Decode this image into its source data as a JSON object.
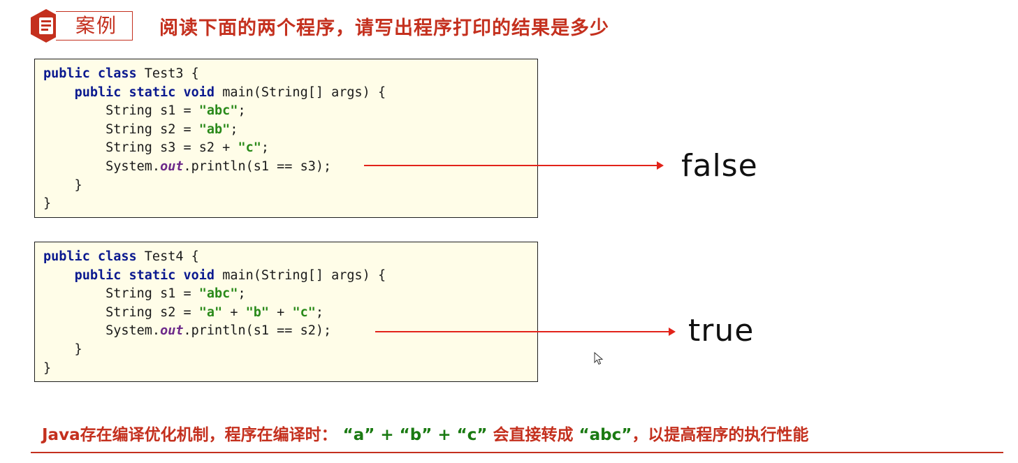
{
  "header": {
    "badge_label": "案例",
    "title": "阅读下面的两个程序，请写出程序打印的结果是多少"
  },
  "programs": [
    {
      "class_name": "Test3",
      "result": "false",
      "lines": [
        "public class Test3 {",
        "public static void main(String[] args) {",
        "String s1 = \"abc\";",
        "String s2 = \"ab\";",
        "String s3 = s2 + \"c\";",
        "System.out.println(s1 == s3);",
        "}",
        "}"
      ]
    },
    {
      "class_name": "Test4",
      "result": "true",
      "lines": [
        "public class Test4 {",
        "public static void main(String[] args) {",
        "String s1 = \"abc\";",
        "String s2 = \"a\" + \"b\" + \"c\";",
        "System.out.println(s1 == s2);",
        "}",
        "}"
      ]
    }
  ],
  "note": {
    "prefix": "Java存在编译优化机制，程序在编译时：",
    "expr": "“a” + “b” + “c”",
    "middle": "会直接转成",
    "result": "“abc”",
    "suffix": "，以提高程序的执行性能"
  },
  "colors": {
    "accent": "#c4301e",
    "keyword": "#0b1a8f",
    "string": "#2a8a1a",
    "field": "#6d2a8a",
    "arrow": "#e2231a",
    "code_bg": "#fffde8"
  },
  "icons": {
    "badge_icon": "document-icon",
    "cursor": "mouse-pointer-icon"
  }
}
